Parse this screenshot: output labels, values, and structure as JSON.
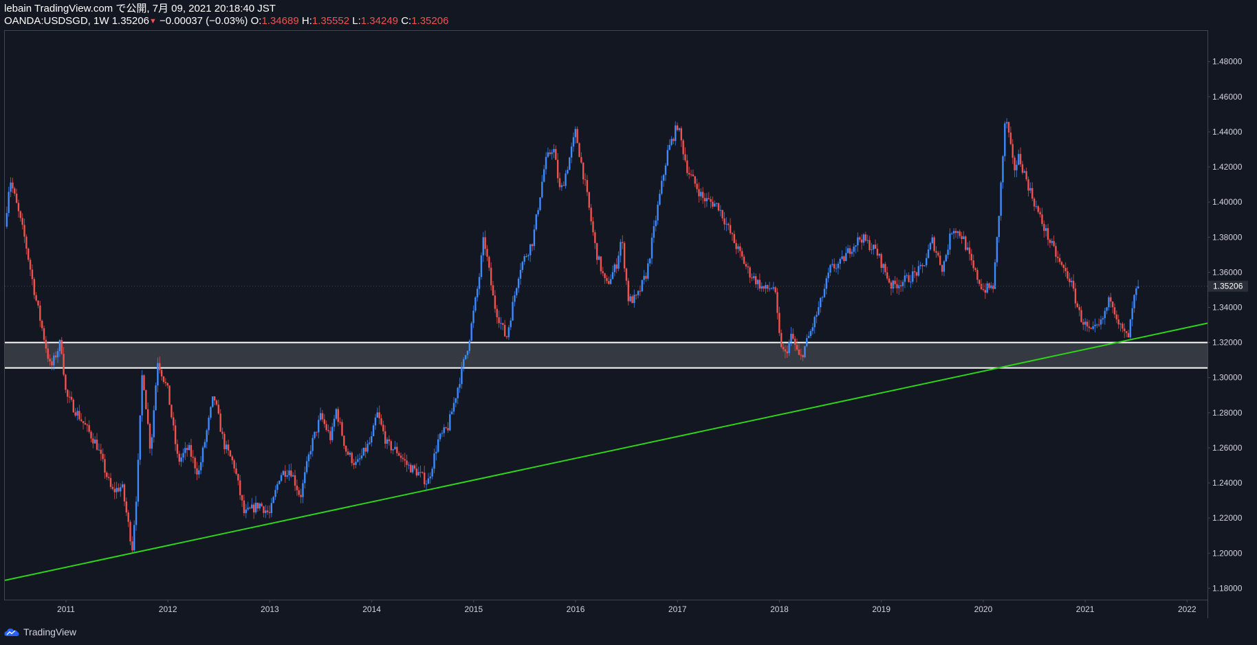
{
  "header": {
    "line1": "lebain TradingView.com で公開, 7月 09, 2021 20:18:40 JST",
    "symbol": "OANDA:USDSGD, 1W",
    "last": "1.35206",
    "arrow": "▼",
    "change": "−0.00037 (−0.03%)",
    "o_label": "O:",
    "o_value": "1.34689",
    "h_label": "H:",
    "h_value": "1.35552",
    "l_label": "L:",
    "l_value": "1.34249",
    "c_label": "C:",
    "c_value": "1.35206"
  },
  "footer": {
    "brand": "TradingView",
    "logo_icon": "tradingview-cloud-icon"
  },
  "colors": {
    "background": "#131722",
    "up": "#2962ff",
    "up_bright": "#3d8bfd",
    "down": "#ef5350",
    "trendline": "#2fd41a",
    "zone_fill": "#3a3d45",
    "zone_border": "#ffffff",
    "axis_text": "#d1d4dc",
    "price_badge": "#2a2e39"
  },
  "chart_data": {
    "type": "candlestick",
    "title": "OANDA:USDSGD, 1W",
    "xlabel": "",
    "ylabel": "",
    "x_ticks": [
      "2011",
      "2012",
      "2013",
      "2014",
      "2015",
      "2016",
      "2017",
      "2018",
      "2019",
      "2020",
      "2021",
      "2022"
    ],
    "y_ticks": [
      "1.18000",
      "1.20000",
      "1.22000",
      "1.24000",
      "1.26000",
      "1.28000",
      "1.30000",
      "1.32000",
      "1.34000",
      "1.36000",
      "1.38000",
      "1.40000",
      "1.42000",
      "1.44000",
      "1.46000",
      "1.48000"
    ],
    "xlim": [
      2010.4,
      2022.2
    ],
    "ylim": [
      1.1735,
      1.4975
    ],
    "current_price_label": "1.35206",
    "current_price": 1.35206,
    "grid": false,
    "support_zone": {
      "top": 1.32,
      "bottom": 1.3055
    },
    "trendline": {
      "points": [
        [
          2010.4,
          1.1845
        ],
        [
          2022.2,
          1.331
        ]
      ]
    },
    "path": [
      [
        2010.4,
        1.386
      ],
      [
        2010.45,
        1.414
      ],
      [
        2010.6,
        1.378
      ],
      [
        2010.7,
        1.346
      ],
      [
        2010.85,
        1.305
      ],
      [
        2010.95,
        1.321
      ],
      [
        2011.0,
        1.29
      ],
      [
        2011.3,
        1.262
      ],
      [
        2011.45,
        1.235
      ],
      [
        2011.55,
        1.238
      ],
      [
        2011.65,
        1.203
      ],
      [
        2011.7,
        1.24
      ],
      [
        2011.75,
        1.305
      ],
      [
        2011.83,
        1.258
      ],
      [
        2011.9,
        1.31
      ],
      [
        2012.0,
        1.292
      ],
      [
        2012.1,
        1.252
      ],
      [
        2012.2,
        1.26
      ],
      [
        2012.3,
        1.245
      ],
      [
        2012.45,
        1.29
      ],
      [
        2012.55,
        1.262
      ],
      [
        2012.65,
        1.25
      ],
      [
        2012.75,
        1.222
      ],
      [
        2012.9,
        1.228
      ],
      [
        2013.0,
        1.222
      ],
      [
        2013.1,
        1.245
      ],
      [
        2013.2,
        1.248
      ],
      [
        2013.3,
        1.232
      ],
      [
        2013.4,
        1.26
      ],
      [
        2013.5,
        1.278
      ],
      [
        2013.6,
        1.265
      ],
      [
        2013.65,
        1.282
      ],
      [
        2013.75,
        1.258
      ],
      [
        2013.85,
        1.25
      ],
      [
        2014.0,
        1.265
      ],
      [
        2014.05,
        1.28
      ],
      [
        2014.15,
        1.262
      ],
      [
        2014.25,
        1.258
      ],
      [
        2014.35,
        1.25
      ],
      [
        2014.45,
        1.246
      ],
      [
        2014.55,
        1.24
      ],
      [
        2014.65,
        1.264
      ],
      [
        2014.75,
        1.272
      ],
      [
        2014.85,
        1.296
      ],
      [
        2014.95,
        1.32
      ],
      [
        2015.05,
        1.355
      ],
      [
        2015.1,
        1.38
      ],
      [
        2015.2,
        1.342
      ],
      [
        2015.32,
        1.322
      ],
      [
        2015.45,
        1.362
      ],
      [
        2015.58,
        1.378
      ],
      [
        2015.7,
        1.422
      ],
      [
        2015.78,
        1.432
      ],
      [
        2015.85,
        1.405
      ],
      [
        2015.92,
        1.42
      ],
      [
        2016.0,
        1.44
      ],
      [
        2016.1,
        1.408
      ],
      [
        2016.2,
        1.372
      ],
      [
        2016.3,
        1.352
      ],
      [
        2016.4,
        1.364
      ],
      [
        2016.45,
        1.38
      ],
      [
        2016.52,
        1.344
      ],
      [
        2016.6,
        1.345
      ],
      [
        2016.7,
        1.36
      ],
      [
        2016.8,
        1.395
      ],
      [
        2016.9,
        1.428
      ],
      [
        2017.0,
        1.444
      ],
      [
        2017.1,
        1.418
      ],
      [
        2017.25,
        1.402
      ],
      [
        2017.4,
        1.398
      ],
      [
        2017.55,
        1.378
      ],
      [
        2017.7,
        1.36
      ],
      [
        2017.85,
        1.35
      ],
      [
        2017.95,
        1.352
      ],
      [
        2018.0,
        1.323
      ],
      [
        2018.05,
        1.312
      ],
      [
        2018.12,
        1.324
      ],
      [
        2018.2,
        1.31
      ],
      [
        2018.3,
        1.325
      ],
      [
        2018.4,
        1.342
      ],
      [
        2018.5,
        1.362
      ],
      [
        2018.6,
        1.365
      ],
      [
        2018.7,
        1.374
      ],
      [
        2018.8,
        1.38
      ],
      [
        2018.95,
        1.372
      ],
      [
        2019.1,
        1.352
      ],
      [
        2019.25,
        1.356
      ],
      [
        2019.4,
        1.362
      ],
      [
        2019.5,
        1.378
      ],
      [
        2019.6,
        1.362
      ],
      [
        2019.7,
        1.386
      ],
      [
        2019.8,
        1.38
      ],
      [
        2019.9,
        1.362
      ],
      [
        2020.0,
        1.35
      ],
      [
        2020.1,
        1.352
      ],
      [
        2020.15,
        1.39
      ],
      [
        2020.22,
        1.45
      ],
      [
        2020.3,
        1.418
      ],
      [
        2020.35,
        1.426
      ],
      [
        2020.45,
        1.408
      ],
      [
        2020.55,
        1.392
      ],
      [
        2020.65,
        1.378
      ],
      [
        2020.75,
        1.365
      ],
      [
        2020.85,
        1.356
      ],
      [
        2020.95,
        1.335
      ],
      [
        2021.05,
        1.325
      ],
      [
        2021.15,
        1.33
      ],
      [
        2021.25,
        1.346
      ],
      [
        2021.35,
        1.328
      ],
      [
        2021.42,
        1.322
      ],
      [
        2021.48,
        1.345
      ],
      [
        2021.52,
        1.35206
      ]
    ]
  }
}
